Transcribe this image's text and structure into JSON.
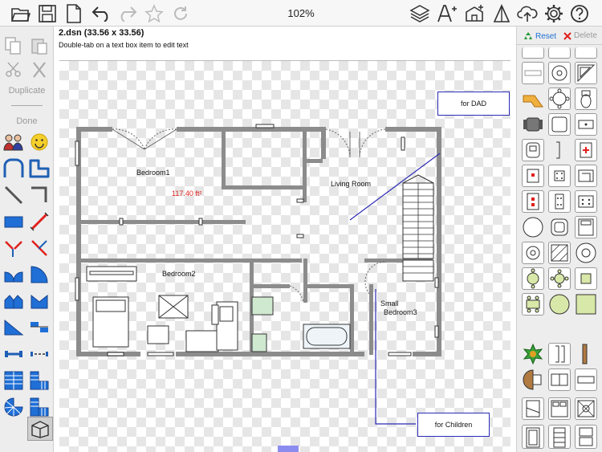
{
  "toolbar": {
    "zoom": "102%",
    "icons": [
      "open-folder-icon",
      "save-icon",
      "new-document-icon",
      "undo-icon",
      "redo-icon",
      "favorite-star-icon",
      "refresh-icon",
      "layers-icon",
      "add-text-icon",
      "add-item-icon",
      "angle-icon",
      "cloud-upload-icon",
      "settings-gear-icon",
      "help-icon"
    ]
  },
  "left_toolbar": {
    "duplicate_label": "Duplicate",
    "done_label": "Done"
  },
  "document": {
    "title": "2.dsn (33.56 x 33.56)",
    "hint": "Double-tab on a text box item to edit text"
  },
  "plan": {
    "rooms": {
      "bedroom1": "Bedroom1",
      "bedroom1_area": "117.40 ft²",
      "living_room": "Living Room",
      "bedroom2": "Bedroom2",
      "small_bedroom3_line1": "Small",
      "small_bedroom3_line2": "Bedroom3"
    },
    "callouts": {
      "dad": "for DAD",
      "children": "for Children"
    },
    "colors": {
      "wall": "#8c8c8c",
      "area_text": "#e0201c",
      "callout_line": "#2b2bb5"
    }
  },
  "right_panel": {
    "reset_label": "Reset",
    "delete_label": "Delete"
  },
  "colors": {
    "accent": "#1f6fd6",
    "selection": "#2b6cd6",
    "green_fixture": "#d8e8a8"
  }
}
